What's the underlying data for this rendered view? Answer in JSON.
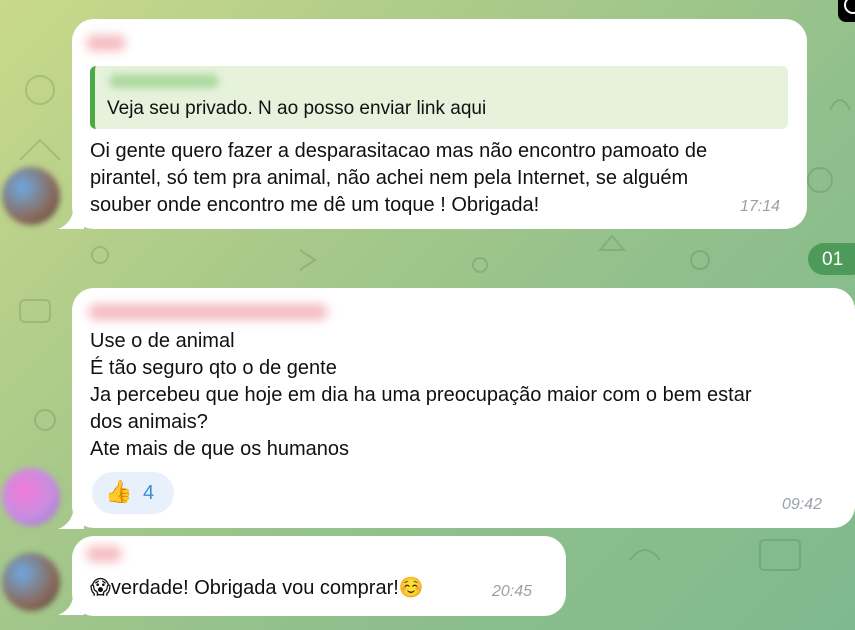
{
  "messages": [
    {
      "reply": {
        "text": "Veja seu privado. N ao posso enviar link aqui"
      },
      "text": "Oi gente quero fazer a desparasitacao mas não encontro pamoato de\npirantel,  só tem pra animal, não achei nem pela Internet, se alguém\nsouber onde encontro me dê um toque ! Obrigada!",
      "time": "17:14"
    },
    {
      "text": "Use o de animal\nÉ tão seguro qto o de gente\nJa percebeu que hoje em dia ha uma preocupação maior com o bem estar\ndos animais?\nAte mais de que os humanos",
      "reaction": {
        "emoji": "👍",
        "count": "4"
      },
      "time": "09:42"
    },
    {
      "lead_emoji": "😱",
      "text": "verdade! Obrigada vou comprar!",
      "trail_emoji": "☺️",
      "time": "20:45"
    }
  ],
  "date_pill": "01",
  "colors": {
    "bubble": "#ffffff",
    "reply_accent": "#4caa46",
    "reaction_count": "#3a8ed8",
    "timestamp": "#9aa1a8",
    "date_pill": "#4e9a5a"
  }
}
